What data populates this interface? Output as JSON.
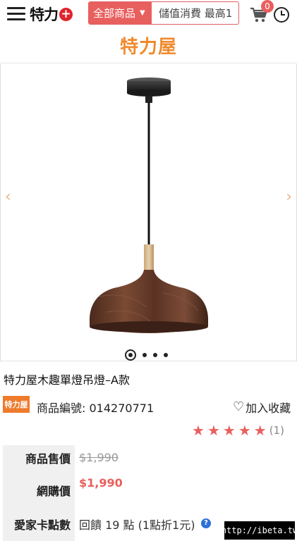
{
  "header": {
    "logo_text": "特力",
    "search_category": "全部商品",
    "search_placeholder": "儲值消費 最高1",
    "cart_count": "0"
  },
  "brand": {
    "name": "特力屋"
  },
  "carousel": {
    "prev_icon": "chevron-left-icon",
    "next_icon": "chevron-right-icon",
    "slide_count": 4,
    "active_slide": 1
  },
  "product": {
    "title": "特力屋木趣單燈吊燈–A款",
    "seller_badge": "特力屋",
    "sku_label": "商品編號:",
    "sku_value": "014270771",
    "favorite_label": "加入收藏",
    "rating_stars": 5,
    "rating_count": "(1)"
  },
  "pricing": {
    "list_price_label": "商品售價",
    "list_price": "$1,990",
    "net_price_label": "網購價",
    "net_price": "$1,990",
    "points_label": "愛家卡點數",
    "points_text": "回饋 19 點 (1點折1元)"
  },
  "watermark": "http://ibeta.tw",
  "colors": {
    "accent": "#e8605e",
    "brand": "#f08a2e",
    "logo_red": "#e0242b"
  }
}
